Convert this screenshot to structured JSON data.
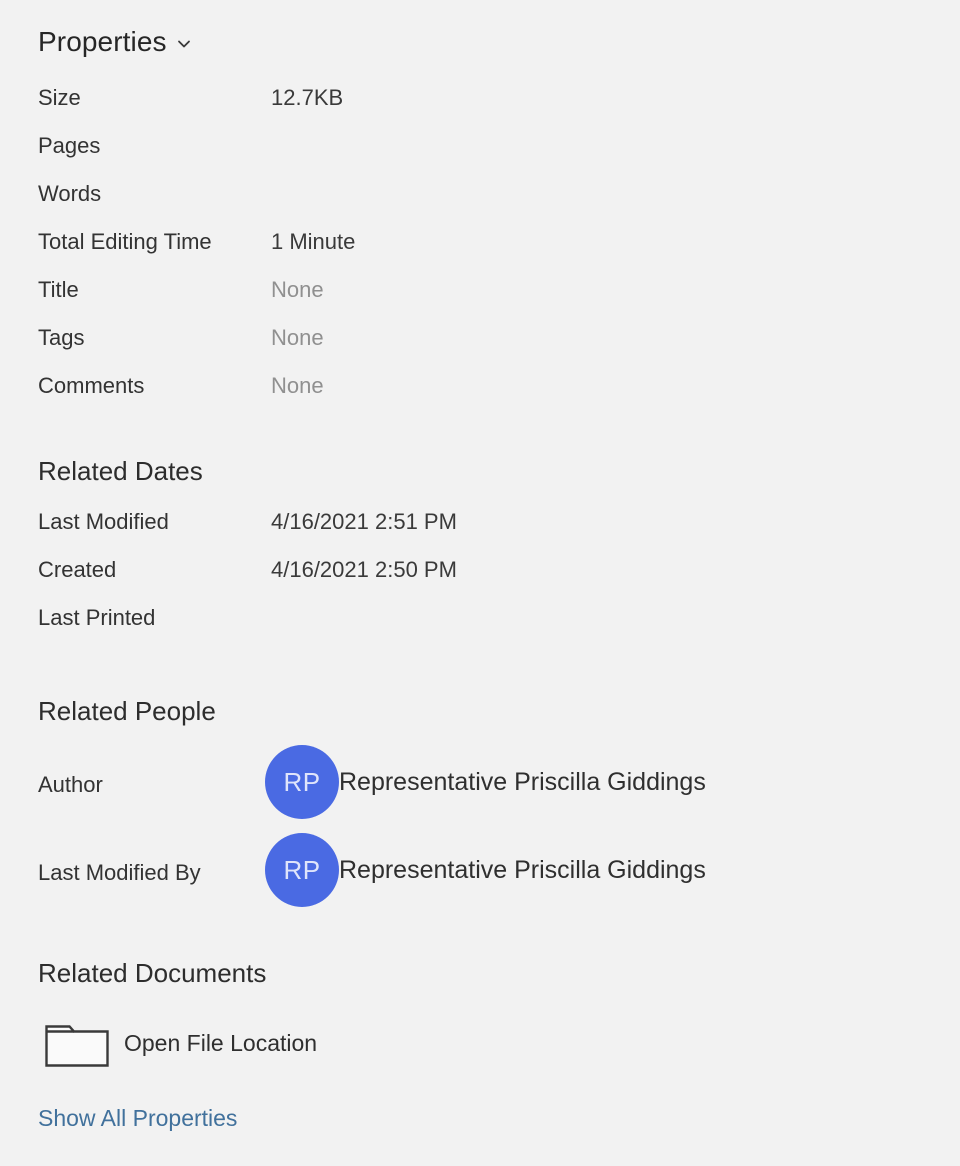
{
  "header": {
    "title": "Properties",
    "chevron_icon": "chevron-down-icon"
  },
  "properties": {
    "rows": [
      {
        "label": "Size",
        "value": "12.7KB",
        "muted": false
      },
      {
        "label": "Pages",
        "value": "",
        "muted": false
      },
      {
        "label": "Words",
        "value": "",
        "muted": false
      },
      {
        "label": "Total Editing Time",
        "value": "1 Minute",
        "muted": false
      },
      {
        "label": "Title",
        "value": "None",
        "muted": true
      },
      {
        "label": "Tags",
        "value": "None",
        "muted": true
      },
      {
        "label": "Comments",
        "value": "None",
        "muted": true
      }
    ]
  },
  "related_dates": {
    "heading": "Related Dates",
    "rows": [
      {
        "label": "Last Modified",
        "value": "4/16/2021 2:51 PM",
        "muted": false
      },
      {
        "label": "Created",
        "value": "4/16/2021 2:50 PM",
        "muted": false
      },
      {
        "label": "Last Printed",
        "value": "",
        "muted": false
      }
    ]
  },
  "related_people": {
    "heading": "Related People",
    "people": [
      {
        "label": "Author",
        "initials": "RP",
        "name": "Representative Priscilla Giddings"
      },
      {
        "label": "Last Modified By",
        "initials": "RP",
        "name": "Representative Priscilla Giddings"
      }
    ]
  },
  "related_documents": {
    "heading": "Related Documents",
    "open_file_location": {
      "icon": "folder-icon",
      "label": "Open File Location"
    }
  },
  "footer": {
    "show_all_properties": "Show All Properties"
  },
  "colors": {
    "background": "#f2f2f2",
    "avatar": "#4a6ae3",
    "link": "#41719c",
    "label_text": "#333333",
    "muted_value": "#909090"
  }
}
